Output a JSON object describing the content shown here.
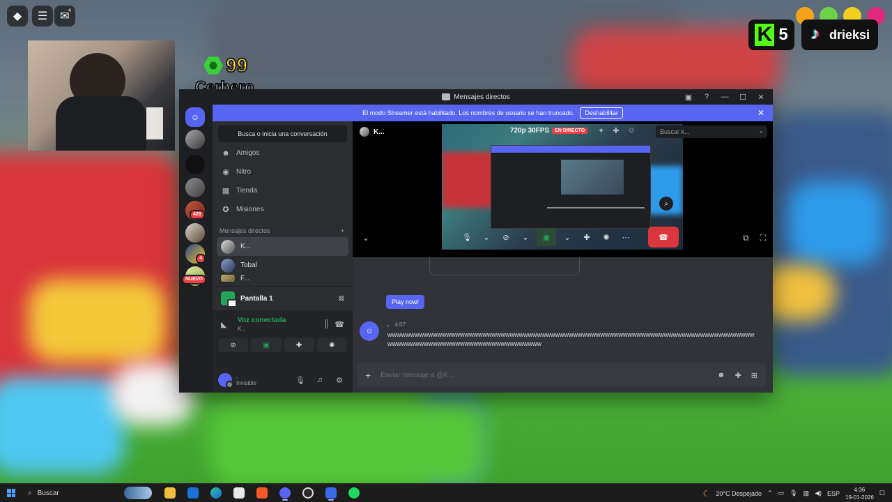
{
  "overlay": {
    "level": "99",
    "game_name": "Cerbero",
    "notifications_count": "4",
    "kick_count": "5",
    "tiktok_user": "drieksi",
    "icons": [
      "roblox-logo-icon",
      "menu-icon",
      "chat-icon"
    ]
  },
  "discord": {
    "window_title": "Mensajes directos",
    "banner": {
      "text": "El modo Streamer está habilitado. Los nombres de usuario se han truncado.",
      "button": "Deshabilitar"
    },
    "guilds": [
      {
        "badge": ""
      },
      {
        "badge": ""
      },
      {
        "badge": ""
      },
      {
        "badge": "429"
      },
      {
        "badge": ""
      },
      {
        "badge": "4"
      },
      {
        "badge": "NUEVO"
      }
    ],
    "search_placeholder": "Busca o inicia una conversación",
    "nav": [
      {
        "label": "Amigos",
        "icon": "friends-icon"
      },
      {
        "label": "Nitro",
        "icon": "nitro-icon"
      },
      {
        "label": "Tienda",
        "icon": "shop-icon"
      },
      {
        "label": "Misiones",
        "icon": "quests-icon"
      }
    ],
    "dm_header": "Mensajes directos",
    "dms": [
      {
        "name": "K...",
        "active": true
      },
      {
        "name": "Tobal",
        "active": false
      },
      {
        "name": "F...",
        "active": false
      }
    ],
    "voice": {
      "screen_title": "Pantalla 1",
      "status": "Voz conectada",
      "channel": "K..."
    },
    "user": {
      "name": ".",
      "status": "Invisible"
    },
    "call": {
      "peer": "K...",
      "quality": "720p 30FPS",
      "live": "EN DIRECTO",
      "search_placeholder": "Buscar k..."
    },
    "play_now": "Play now!",
    "message": {
      "author": ".",
      "time": "4:07",
      "text": "wwwwwwwwwwwwwwwwwwwwwwwwwwwwwwwwwwwwwwwwwwwwwwwwwwwwwwwwwwwwwwwwwwwwwwwwwwwwwwwwwwwwwwwwwwwwwwwwwwwwwwwwwwwwwwwwwww"
    },
    "composer_placeholder": "Enviar mensaje a @K..."
  },
  "taskbar": {
    "search": "Buscar",
    "weather": "20°C  Despejado",
    "language": "ESP",
    "time": "4:36",
    "date": "19-01-2026"
  },
  "colors": {
    "blurple": "#5865f2",
    "green": "#23a55a",
    "red": "#da373c"
  }
}
